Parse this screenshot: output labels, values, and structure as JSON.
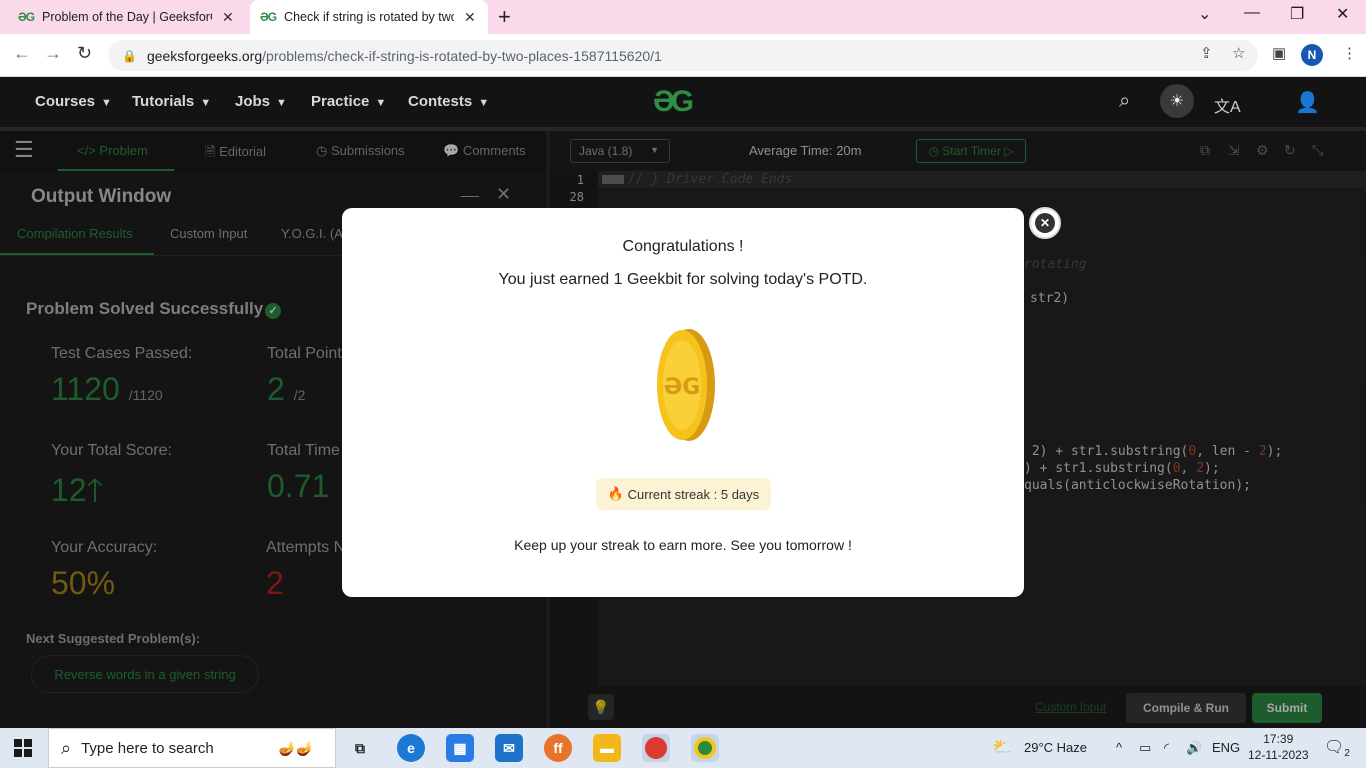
{
  "browser": {
    "tabs": [
      {
        "title": "Problem of the Day | GeeksforGe",
        "favicon": "gfg-icon"
      },
      {
        "title": "Check if string is rotated by two",
        "favicon": "gfg-icon"
      }
    ],
    "url_host": "geeksforgeeks.org",
    "url_path": "/problems/check-if-string-is-rotated-by-two-places-1587115620/1",
    "profile_initial": "N"
  },
  "site_nav": {
    "menus": [
      "Courses",
      "Tutorials",
      "Jobs",
      "Practice",
      "Contests"
    ],
    "logo": "GG"
  },
  "left_panel": {
    "tabs": [
      "</> Problem",
      "Editorial",
      "Submissions",
      "Comments"
    ],
    "output_title": "Output Window",
    "output_tabs": [
      "Compilation Results",
      "Custom Input",
      "Y.O.G.I. (AI"
    ],
    "status": "Problem Solved Successfully",
    "stats": {
      "test_cases_label": "Test Cases Passed:",
      "test_cases_value": "1120",
      "test_cases_total": "/1120",
      "total_points_label": "Total Point",
      "total_points_value": "2",
      "total_points_total": "/2",
      "score_label": "Your Total Score:",
      "score_value": "12",
      "time_label": "Total Time",
      "time_value": "0.71",
      "accuracy_label": "Your Accuracy:",
      "accuracy_value": "50%",
      "attempts_label": "Attempts N",
      "attempts_value": "2"
    },
    "next_label": "Next Suggested Problem(s):",
    "next_problem": "Reverse words in a given string"
  },
  "editor": {
    "language": "Java (1.8)",
    "avg_time": "Average Time: 20m",
    "start_timer": "Start Timer",
    "line_numbers": [
      "1",
      "28"
    ],
    "code_lines": {
      "l1": "// } Driver Code Ends",
      "l2": "rotating",
      "l3": "str2)",
      "l4a": " 2) + str1.substring(",
      "l4b": "0",
      "l4c": ", len - ",
      "l4d": "2",
      "l4e": ");",
      "l5a": ") + str1.substring(",
      "l5b": "0",
      "l5c": ", ",
      "l5d": "2",
      "l5e": ");",
      "l6": "quals(anticlockwiseRotation);"
    },
    "custom_input": "Custom Input",
    "compile_run": "Compile & Run",
    "submit": "Submit"
  },
  "modal": {
    "title": "Congratulations !",
    "subtitle": "You just earned 1 Geekbit for solving today's POTD.",
    "streak": "Current streak : 5 days",
    "footer": "Keep up your streak to earn more. See you tomorrow !"
  },
  "taskbar": {
    "search_placeholder": "Type here to search",
    "weather": "29°C  Haze",
    "lang": "ENG",
    "time": "17:39",
    "date": "12-11-2023",
    "notifications": "2"
  }
}
